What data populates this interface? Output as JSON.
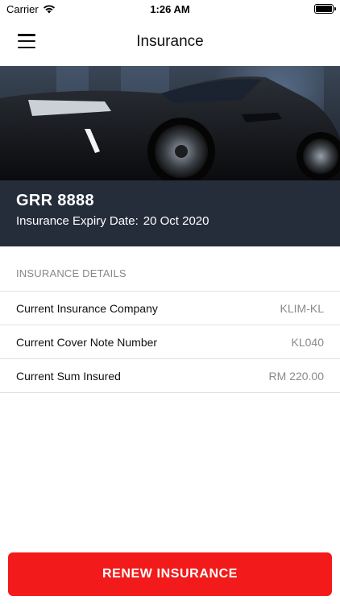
{
  "status_bar": {
    "carrier": "Carrier",
    "time": "1:26 AM"
  },
  "nav": {
    "title": "Insurance"
  },
  "vehicle": {
    "plate": "GRR 8888",
    "expiry_label": "Insurance Expiry Date:",
    "expiry_value": "20 Oct 2020"
  },
  "details": {
    "header": "INSURANCE DETAILS",
    "rows": [
      {
        "label": "Current Insurance Company",
        "value": "KLIM-KL"
      },
      {
        "label": "Current Cover Note Number",
        "value": "KL040"
      },
      {
        "label": "Current Sum Insured",
        "value": "RM 220.00"
      }
    ]
  },
  "actions": {
    "renew_label": "RENEW INSURANCE"
  },
  "colors": {
    "accent": "#f21a1a",
    "panel": "#252d3a"
  }
}
